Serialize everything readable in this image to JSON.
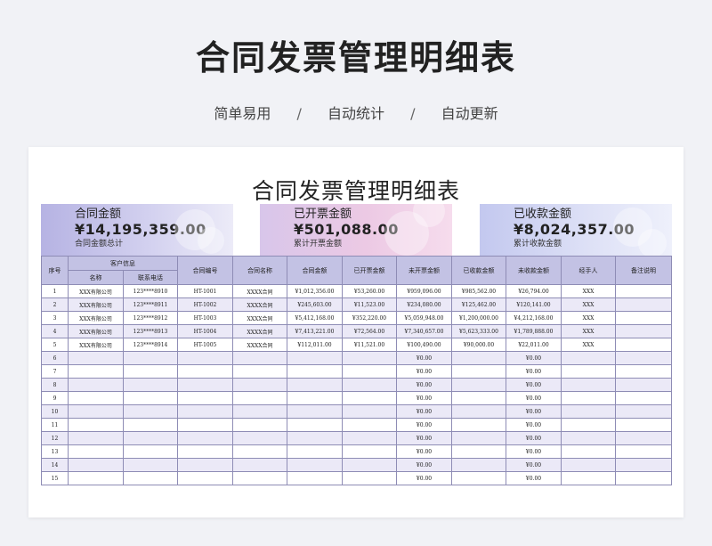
{
  "banner": {
    "title": "合同发票管理明细表",
    "tags": [
      "简单易用",
      "自动统计",
      "自动更新"
    ],
    "separator": "/"
  },
  "sheet": {
    "title": "合同发票管理明细表",
    "cards": [
      {
        "label": "合同金额",
        "value": "¥14,195,359.00",
        "sub": "合同金额总计"
      },
      {
        "label": "已开票金额",
        "value": "¥501,088.00",
        "sub": "累计开票金额"
      },
      {
        "label": "已收款金额",
        "value": "¥8,024,357.00",
        "sub": "累计收款金额"
      }
    ],
    "headers": {
      "seq": "序号",
      "customer_group": "客户信息",
      "name": "名称",
      "phone": "联系电话",
      "contract_no": "合同编号",
      "contract_name": "合同名称",
      "contract_amount": "合同金额",
      "invoiced": "已开票金额",
      "uninvoiced": "未开票金额",
      "received": "已收款金额",
      "unreceived": "未收款金额",
      "handler": "经手人",
      "remark": "备注说明"
    },
    "rows": [
      [
        "1",
        "XXX有限公司",
        "123****8910",
        "HT-1001",
        "XXXX合同",
        "¥1,012,356.00",
        "¥53,260.00",
        "¥959,096.00",
        "¥985,562.00",
        "¥26,794.00",
        "XXX",
        ""
      ],
      [
        "2",
        "XXX有限公司",
        "123****8911",
        "HT-1002",
        "XXXX合同",
        "¥245,603.00",
        "¥11,523.00",
        "¥234,080.00",
        "¥125,462.00",
        "¥120,141.00",
        "XXX",
        ""
      ],
      [
        "3",
        "XXX有限公司",
        "123****8912",
        "HT-1003",
        "XXXX合同",
        "¥5,412,168.00",
        "¥352,220.00",
        "¥5,059,948.00",
        "¥1,200,000.00",
        "¥4,212,168.00",
        "XXX",
        ""
      ],
      [
        "4",
        "XXX有限公司",
        "123****8913",
        "HT-1004",
        "XXXX合同",
        "¥7,413,221.00",
        "¥72,564.00",
        "¥7,340,657.00",
        "¥5,623,333.00",
        "¥1,789,888.00",
        "XXX",
        ""
      ],
      [
        "5",
        "XXX有限公司",
        "123****8914",
        "HT-1005",
        "XXXX合同",
        "¥112,011.00",
        "¥11,521.00",
        "¥100,490.00",
        "¥90,000.00",
        "¥22,011.00",
        "XXX",
        ""
      ],
      [
        "6",
        "",
        "",
        "",
        "",
        "",
        "",
        "¥0.00",
        "",
        "¥0.00",
        "",
        ""
      ],
      [
        "7",
        "",
        "",
        "",
        "",
        "",
        "",
        "¥0.00",
        "",
        "¥0.00",
        "",
        ""
      ],
      [
        "8",
        "",
        "",
        "",
        "",
        "",
        "",
        "¥0.00",
        "",
        "¥0.00",
        "",
        ""
      ],
      [
        "9",
        "",
        "",
        "",
        "",
        "",
        "",
        "¥0.00",
        "",
        "¥0.00",
        "",
        ""
      ],
      [
        "10",
        "",
        "",
        "",
        "",
        "",
        "",
        "¥0.00",
        "",
        "¥0.00",
        "",
        ""
      ],
      [
        "11",
        "",
        "",
        "",
        "",
        "",
        "",
        "¥0.00",
        "",
        "¥0.00",
        "",
        ""
      ],
      [
        "12",
        "",
        "",
        "",
        "",
        "",
        "",
        "¥0.00",
        "",
        "¥0.00",
        "",
        ""
      ],
      [
        "13",
        "",
        "",
        "",
        "",
        "",
        "",
        "¥0.00",
        "",
        "¥0.00",
        "",
        ""
      ],
      [
        "14",
        "",
        "",
        "",
        "",
        "",
        "",
        "¥0.00",
        "",
        "¥0.00",
        "",
        ""
      ],
      [
        "15",
        "",
        "",
        "",
        "",
        "",
        "",
        "¥0.00",
        "",
        "¥0.00",
        "",
        ""
      ]
    ]
  }
}
